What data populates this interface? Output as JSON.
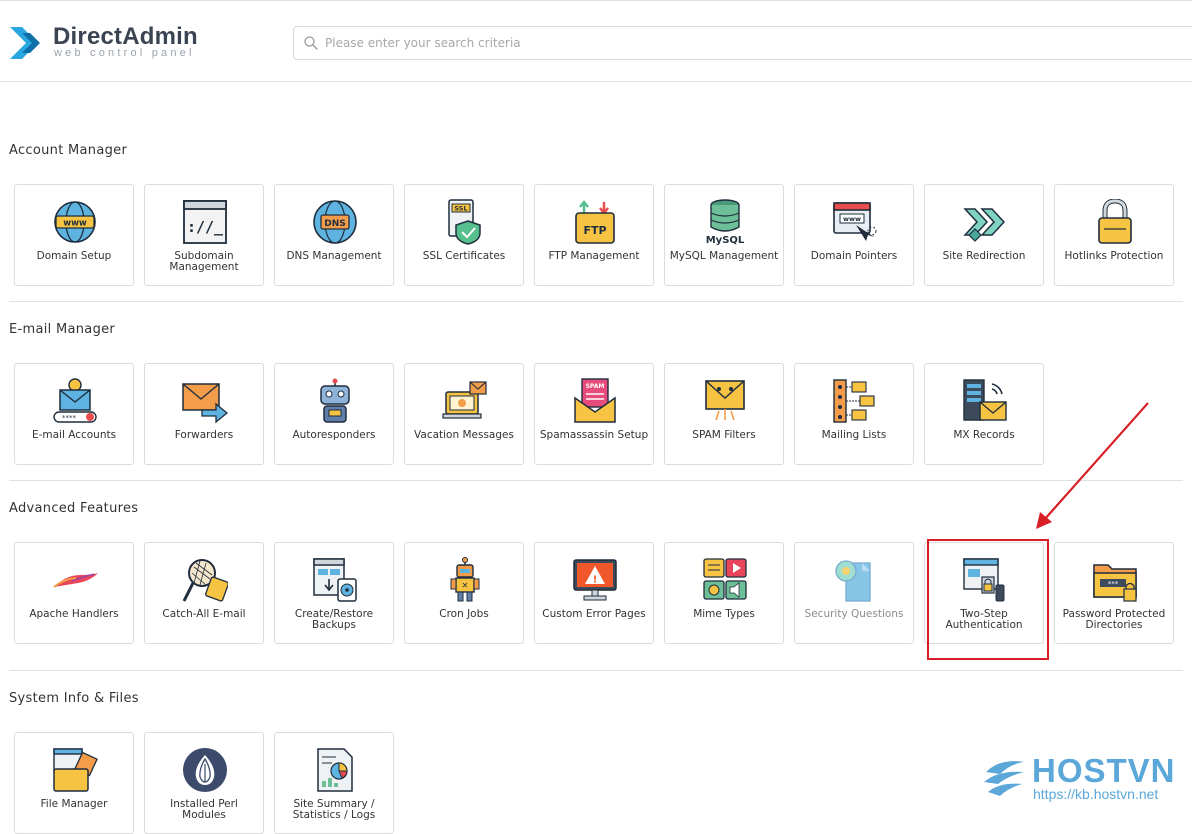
{
  "header": {
    "logo_title": "DirectAdmin",
    "logo_subtitle": "web control panel",
    "search_placeholder": "Please enter your search criteria",
    "search_value": ""
  },
  "sections": [
    {
      "title": "Account Manager",
      "items": [
        {
          "label": "Domain Setup",
          "icon": "globe-www-icon"
        },
        {
          "label": "Subdomain Management",
          "icon": "terminal-window-icon"
        },
        {
          "label": "DNS Management",
          "icon": "dns-globe-icon"
        },
        {
          "label": "SSL Certificates",
          "icon": "ssl-shield-icon"
        },
        {
          "label": "FTP Management",
          "icon": "ftp-folder-icon"
        },
        {
          "label": "MySQL Management",
          "icon": "database-icon"
        },
        {
          "label": "Domain Pointers",
          "icon": "browser-pointer-icon"
        },
        {
          "label": "Site Redirection",
          "icon": "redirect-arrows-icon"
        },
        {
          "label": "Hotlinks Protection",
          "icon": "padlock-icon"
        }
      ]
    },
    {
      "title": "E-mail Manager",
      "items": [
        {
          "label": "E-mail Accounts",
          "icon": "email-account-icon"
        },
        {
          "label": "Forwarders",
          "icon": "email-forward-icon"
        },
        {
          "label": "Autoresponders",
          "icon": "robot-icon"
        },
        {
          "label": "Vacation Messages",
          "icon": "laptop-mail-icon"
        },
        {
          "label": "Spamassassin Setup",
          "icon": "spam-envelope-icon"
        },
        {
          "label": "SPAM Filters",
          "icon": "spam-filter-icon"
        },
        {
          "label": "Mailing Lists",
          "icon": "mailing-list-icon"
        },
        {
          "label": "MX Records",
          "icon": "mail-server-icon"
        }
      ]
    },
    {
      "title": "Advanced Features",
      "items": [
        {
          "label": "Apache Handlers",
          "icon": "apache-feather-icon"
        },
        {
          "label": "Catch-All E-mail",
          "icon": "net-catch-icon"
        },
        {
          "label": "Create/Restore Backups",
          "icon": "backup-icon"
        },
        {
          "label": "Cron Jobs",
          "icon": "robot-cron-icon"
        },
        {
          "label": "Custom Error Pages",
          "icon": "monitor-warning-icon"
        },
        {
          "label": "Mime Types",
          "icon": "media-types-icon"
        },
        {
          "label": "Security Questions",
          "icon": "question-document-icon",
          "muted": true
        },
        {
          "label": "Two-Step Authentication",
          "icon": "two-step-lock-icon"
        },
        {
          "label": "Password Protected Directories",
          "icon": "password-folder-icon"
        }
      ]
    },
    {
      "title": "System Info & Files",
      "items": [
        {
          "label": "File Manager",
          "icon": "file-manager-icon"
        },
        {
          "label": "Installed Perl Modules",
          "icon": "perl-onion-icon"
        },
        {
          "label": "Site Summary / Statistics / Logs",
          "icon": "statistics-document-icon"
        }
      ]
    }
  ],
  "watermark": {
    "brand": "HOSTVN",
    "url": "https://kb.hostvn.net"
  },
  "colors": {
    "highlight": "#d81f25",
    "accent_blue": "#5ba7d9",
    "logo_blue": "#2aa7e0"
  }
}
